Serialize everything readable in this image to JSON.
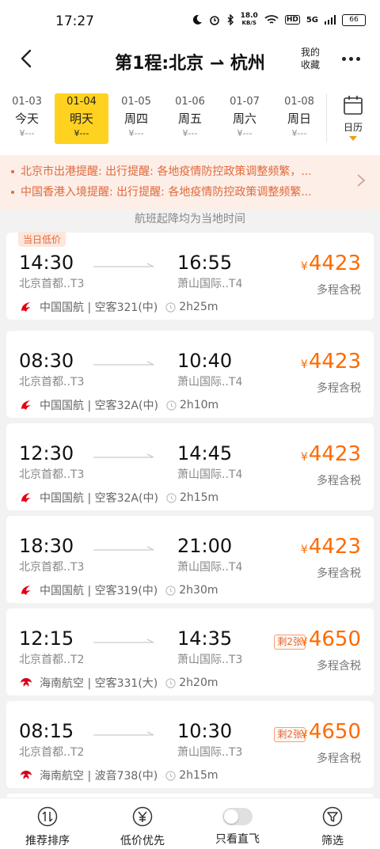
{
  "status_bar": {
    "time": "17:27",
    "speed_value": "18.0",
    "speed_unit": "KB/S",
    "hd": "HD",
    "network": "5G",
    "battery": "66"
  },
  "header": {
    "title": "第1程:北京 ⇀ 杭州",
    "fav_line1": "我的",
    "fav_line2": "收藏"
  },
  "dates": [
    {
      "date": "01-03",
      "weekday": "今天",
      "price": "¥---",
      "selected": false
    },
    {
      "date": "01-04",
      "weekday": "明天",
      "price": "¥---",
      "selected": true
    },
    {
      "date": "01-05",
      "weekday": "周四",
      "price": "¥---",
      "selected": false
    },
    {
      "date": "01-06",
      "weekday": "周五",
      "price": "¥---",
      "selected": false
    },
    {
      "date": "01-07",
      "weekday": "周六",
      "price": "¥---",
      "selected": false
    },
    {
      "date": "01-08",
      "weekday": "周日",
      "price": "¥---",
      "selected": false
    }
  ],
  "calendar_label": "日历",
  "notices": [
    "北京市出港提醒: 出行提醒:  各地疫情防控政策调整频繁，...",
    "中国香港入境提醒: 出行提醒:  各地疫情防控政策调整频繁..."
  ],
  "local_time_note": "航班起降均为当地时间",
  "flights": [
    {
      "badge": "当日低价",
      "dep_time": "14:30",
      "dep_airport": "北京首都..T3",
      "arr_time": "16:55",
      "arr_airport": "萧山国际..T4",
      "price": "4423",
      "tax": "多程含税",
      "remain": "",
      "airline": "中国国航 | 空客321(中)",
      "duration": "2h25m",
      "airline_code": "CA"
    },
    {
      "badge": "",
      "dep_time": "08:30",
      "dep_airport": "北京首都..T3",
      "arr_time": "10:40",
      "arr_airport": "萧山国际..T4",
      "price": "4423",
      "tax": "多程含税",
      "remain": "",
      "airline": "中国国航 | 空客32A(中)",
      "duration": "2h10m",
      "airline_code": "CA"
    },
    {
      "badge": "",
      "dep_time": "12:30",
      "dep_airport": "北京首都..T3",
      "arr_time": "14:45",
      "arr_airport": "萧山国际..T4",
      "price": "4423",
      "tax": "多程含税",
      "remain": "",
      "airline": "中国国航 | 空客32A(中)",
      "duration": "2h15m",
      "airline_code": "CA"
    },
    {
      "badge": "",
      "dep_time": "18:30",
      "dep_airport": "北京首都..T3",
      "arr_time": "21:00",
      "arr_airport": "萧山国际..T4",
      "price": "4423",
      "tax": "多程含税",
      "remain": "",
      "airline": "中国国航 | 空客319(中)",
      "duration": "2h30m",
      "airline_code": "CA"
    },
    {
      "badge": "",
      "dep_time": "12:15",
      "dep_airport": "北京首都..T2",
      "arr_time": "14:35",
      "arr_airport": "萧山国际..T3",
      "price": "4650",
      "tax": "多程含税",
      "remain": "剩2张",
      "airline": "海南航空 | 空客331(大)",
      "duration": "2h20m",
      "airline_code": "HU"
    },
    {
      "badge": "",
      "dep_time": "08:15",
      "dep_airport": "北京首都..T2",
      "arr_time": "10:30",
      "arr_airport": "萧山国际..T3",
      "price": "4650",
      "tax": "多程含税",
      "remain": "剩2张",
      "airline": "海南航空 | 波音738(中)",
      "duration": "2h15m",
      "airline_code": "HU"
    }
  ],
  "currency_symbol": "¥",
  "bottom_tabs": [
    {
      "label": "推荐排序",
      "icon": "sort-icon"
    },
    {
      "label": "低价优先",
      "icon": "yen-icon"
    },
    {
      "label": "只看直飞",
      "icon": "toggle-switch"
    },
    {
      "label": "筛选",
      "icon": "filter-icon"
    }
  ],
  "colors": {
    "accent": "#ff6a00",
    "selected_date": "#ffd21f",
    "notice_bg": "#fdeee8",
    "notice_text": "#e06a3a",
    "air_china_red": "#e60012",
    "hainan_red": "#d6001c"
  }
}
